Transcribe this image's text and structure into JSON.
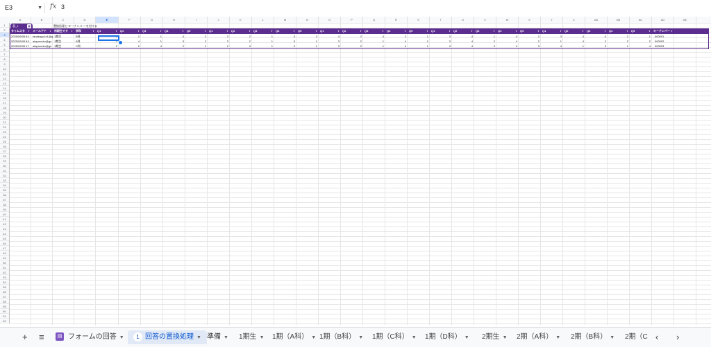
{
  "formula_bar": {
    "cell_ref": "E3",
    "fx_icon": "fx",
    "value": "3"
  },
  "column_letters": [
    "A",
    "B",
    "C",
    "D",
    "E",
    "F",
    "G",
    "H",
    "I",
    "J",
    "K",
    "L",
    "M",
    "N",
    "O",
    "P",
    "Q",
    "R",
    "S",
    "T",
    "U",
    "V",
    "W",
    "X",
    "Y",
    "Z",
    "AA",
    "AB",
    "AC",
    "AD",
    "AE"
  ],
  "selected_column": "E",
  "row_numbers": [
    "1",
    "2",
    "3",
    "4",
    "5",
    "6",
    "7",
    "8",
    "9",
    "10",
    "11",
    "12",
    "13",
    "14",
    "15",
    "16",
    "17",
    "18",
    "19",
    "20",
    "21",
    "22",
    "23",
    "24",
    "25",
    "26",
    "27",
    "28",
    "29",
    "30",
    "31",
    "32",
    "33",
    "34",
    "35",
    "36",
    "37",
    "38",
    "39",
    "40",
    "41",
    "42",
    "43",
    "44",
    "45",
    "46",
    "47",
    "48",
    "49",
    "50",
    "51",
    "52",
    "53",
    "54",
    "55",
    "56",
    "57",
    "58",
    "59",
    "60",
    "61",
    "62"
  ],
  "selected_row": "3",
  "table_chip": {
    "label": "表_1",
    "icon": "table-icon"
  },
  "note": "置換処理と\"キーナンバー\"を付ける",
  "headers": [
    "タイムスタ",
    "メールアド",
    "何期生です",
    "学科",
    "Q1",
    "Q2",
    "Q3",
    "Q4",
    "Q5",
    "Q1",
    "Q2",
    "Q3",
    "Q4",
    "Q5",
    "Q1",
    "Q2",
    "Q3",
    "Q4",
    "Q5",
    "Q1",
    "Q2",
    "Q3",
    "Q4",
    "Q5",
    "Q1",
    "Q2",
    "Q3",
    "Q4",
    "Q5",
    "キーナンバー"
  ],
  "rows": [
    [
      "2025/09/08 8:1",
      "tanakayu1e1@g",
      "1期生",
      "B科",
      "1",
      "2",
      "1",
      "4",
      "2",
      "3",
      "2",
      "1",
      "3",
      "2",
      "4",
      "2",
      "4",
      "2",
      "1",
      "3",
      "4",
      "1",
      "4",
      "2",
      "3",
      "4",
      "4",
      "2",
      "1",
      "000001"
    ],
    [
      "2025/09/08 8:1",
      "atapmorko@gn",
      "1期生",
      "A科",
      "3",
      "4",
      "1",
      "3",
      "2",
      "3",
      "2",
      "1",
      "3",
      "1",
      "3",
      "2",
      "1",
      "4",
      "1",
      "3",
      "4",
      "2",
      "4",
      "2",
      "1",
      "4",
      "2",
      "2",
      "2",
      "000002"
    ],
    [
      "2025/09/08 17",
      "atapmorko@gn",
      "1期生",
      "C科",
      "2",
      "2",
      "4",
      "2",
      "1",
      "2",
      "3",
      "1",
      "2",
      "1",
      "3",
      "2",
      "1",
      "4",
      "1",
      "3",
      "4",
      "2",
      "3",
      "3",
      "4",
      "1",
      "3",
      "1",
      "4",
      "000003"
    ]
  ],
  "sheet_tabs": [
    {
      "label": "フォームの回答",
      "icon": "form-icon"
    },
    {
      "label": "回答の置換処理",
      "badge": "1",
      "active": true
    },
    {
      "label": "準備"
    },
    {
      "label": "1期生"
    },
    {
      "label": "1期（A科）"
    },
    {
      "label": "1期（B科）"
    },
    {
      "label": "1期（C科）"
    },
    {
      "label": "1期（D科）"
    },
    {
      "label": "2期生"
    },
    {
      "label": "2期（A科）"
    },
    {
      "label": "2期（B科）"
    },
    {
      "label": "2期（C"
    }
  ],
  "tab_controls": {
    "add": "+",
    "all_sheets": "≡",
    "prev": "‹",
    "next": "›"
  },
  "colors": {
    "header_purple": "#5b2d8e",
    "selection_blue": "#1a73e8",
    "active_tab": "#e1e9f7"
  }
}
